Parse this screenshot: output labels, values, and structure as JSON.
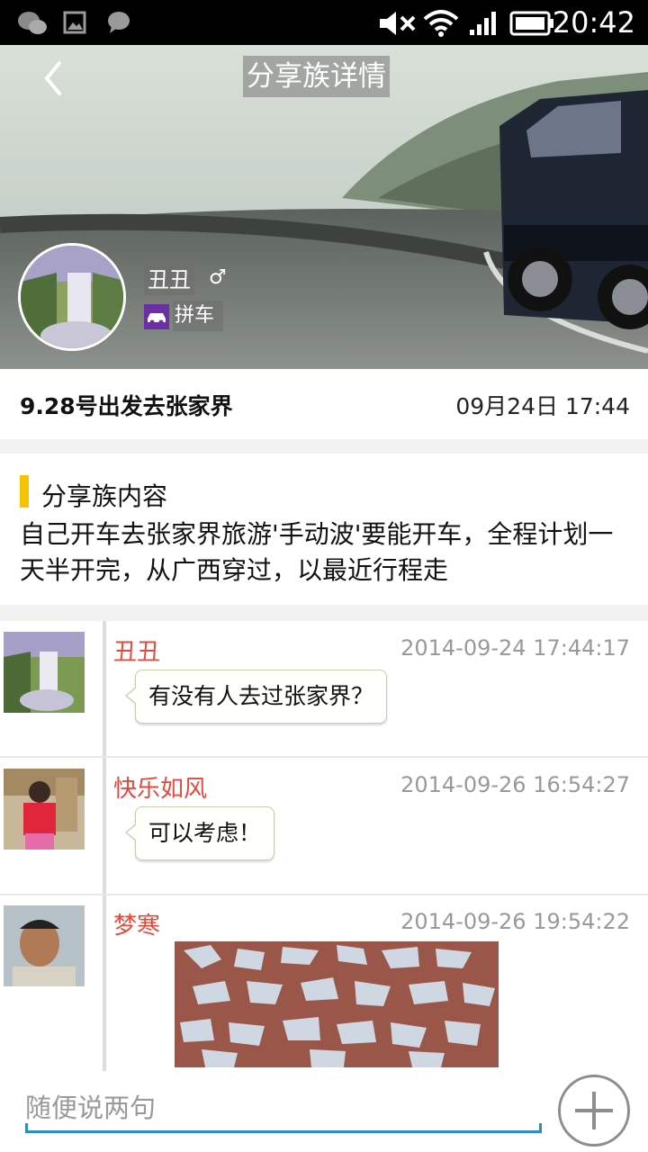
{
  "status_bar": {
    "time": "20:42"
  },
  "header": {
    "title": "分享族详情"
  },
  "user": {
    "name": "丑丑",
    "gender_symbol": "♂",
    "tag": "拼车"
  },
  "trip": {
    "title": "9.28号出发去张家界",
    "datetime": "09月24日 17:44"
  },
  "content": {
    "heading": "分享族内容",
    "body": "自己开车去张家界旅游'手动波'要能开车，全程计划一天半开完，从广西穿过，以最近行程走"
  },
  "comments": [
    {
      "name": "丑丑",
      "time": "2014-09-24 17:44:17",
      "text": "有没有人去过张家界？"
    },
    {
      "name": "快乐如风",
      "time": "2014-09-26 16:54:27",
      "text": "可以考虑！"
    },
    {
      "name": "梦寒",
      "time": "2014-09-26 19:54:22",
      "text": ""
    }
  ],
  "input": {
    "placeholder": "随便说两句"
  },
  "colors": {
    "name_red": "#e8483c",
    "accent_blue": "#2b8ad0",
    "section_yellow": "#f5c400",
    "tag_purple": "#6b2fa3"
  },
  "icons": [
    "wechat-icon",
    "image-icon",
    "message-icon",
    "mute-icon",
    "wifi-icon",
    "signal-icon",
    "battery-icon",
    "back-arrow-icon",
    "car-icon",
    "plus-icon"
  ]
}
